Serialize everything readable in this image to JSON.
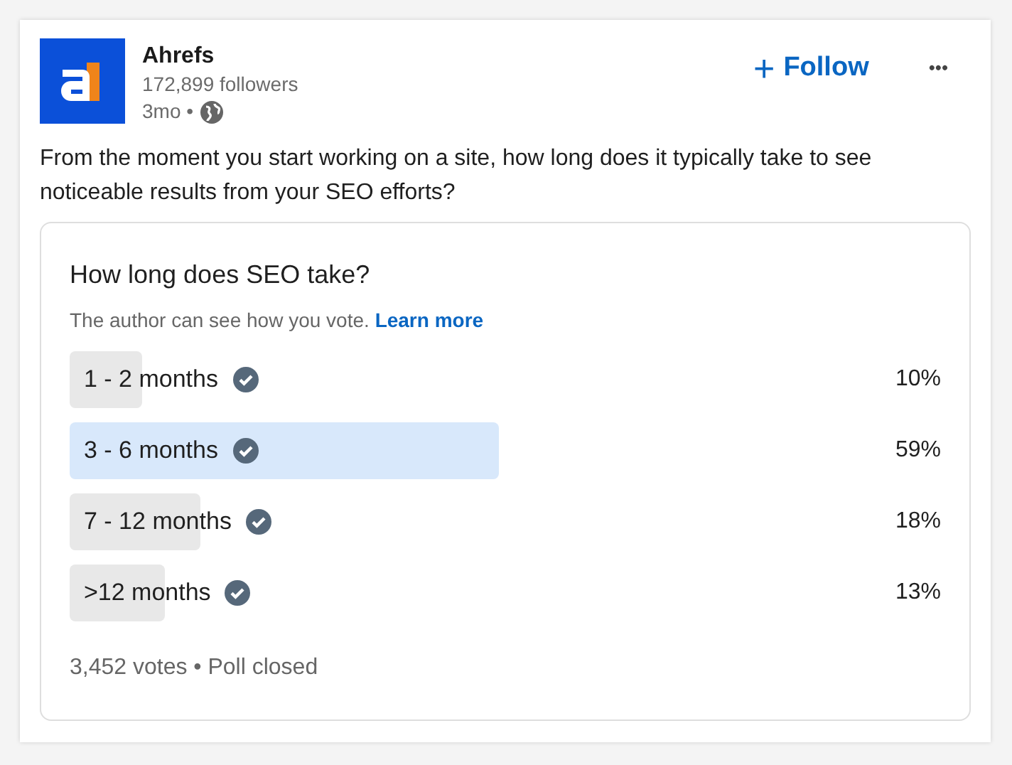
{
  "author": {
    "name": "Ahrefs",
    "followers": "172,899 followers",
    "time": "3mo •"
  },
  "follow": {
    "icon": "+",
    "label": "Follow"
  },
  "more": "•••",
  "text": "From the moment you start working on a site, how long does it typically take to see noticeable results from your SEO efforts?",
  "poll": {
    "title": "How long does SEO take?",
    "note": "The author can see how you vote.",
    "link": "Learn more",
    "options": [
      {
        "label": "1 - 2 months",
        "percent": "10%",
        "selected": false
      },
      {
        "label": "3 - 6 months",
        "percent": "59%",
        "selected": true
      },
      {
        "label": "7 - 12 months",
        "percent": "18%",
        "selected": false
      },
      {
        "label": ">12 months",
        "percent": "13%",
        "selected": false
      }
    ],
    "footer": "3,452 votes • Poll closed"
  }
}
